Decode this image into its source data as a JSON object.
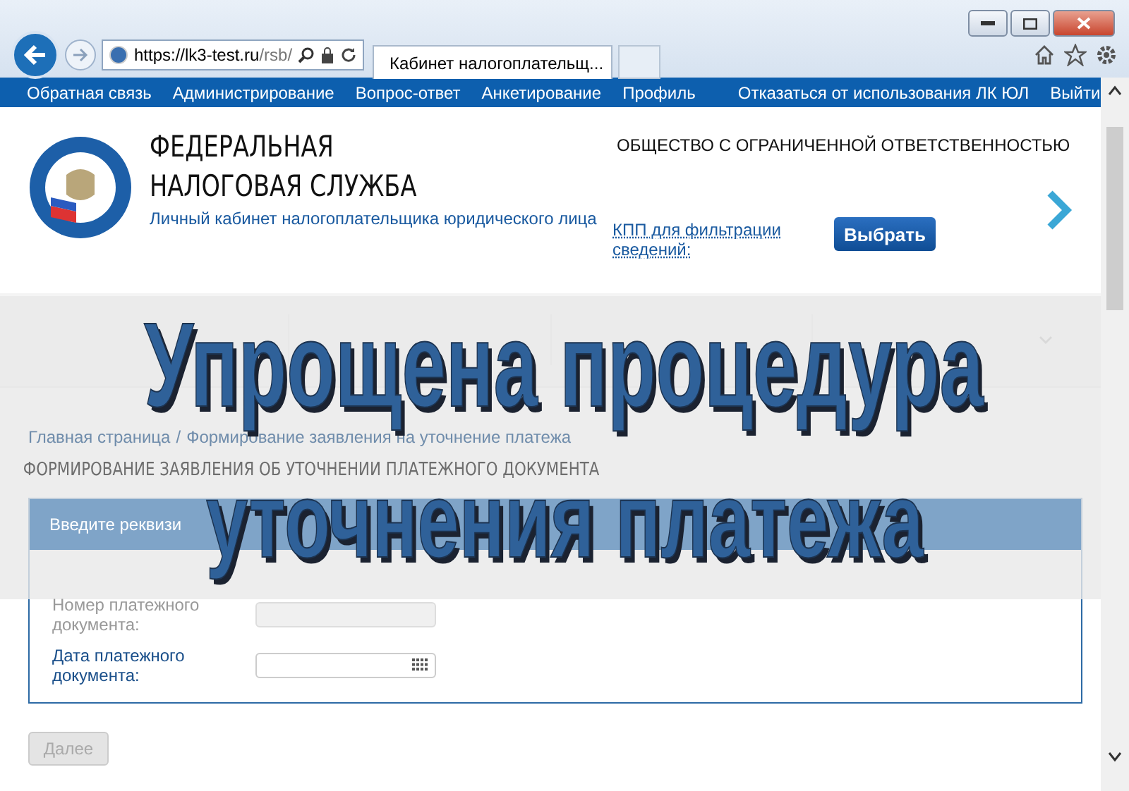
{
  "browser": {
    "address_host": "https://lk3-test.ru",
    "address_path": "/rsb/",
    "tab_title": "Кабинет налогоплательщ..."
  },
  "top_menu": {
    "left": [
      "Обратная связь",
      "Администрирование",
      "Вопрос-ответ",
      "Анкетирование",
      "Профиль"
    ],
    "right": [
      "Отказаться от использования ЛК ЮЛ",
      "Выйти"
    ]
  },
  "header": {
    "title_lines": [
      "ФЕДЕРАЛЬНАЯ",
      "НАЛОГОВАЯ СЛУЖБА"
    ],
    "subtitle": "Личный кабинет налогоплательщика юридического лица",
    "company": "ОБЩЕСТВО С ОГРАНИЧЕННОЙ ОТВЕТСТВЕННОСТЬЮ",
    "kpp_label": "КПП для фильтрации сведений:",
    "select_button": "Выбрать"
  },
  "breadcrumb": {
    "items": [
      "Главная страница",
      "Формирование заявления на уточнение платежа"
    ],
    "separator": "/"
  },
  "page_title": "ФОРМИРОВАНИЕ ЗАЯВЛЕНИЯ ОБ УТОЧНЕНИИ ПЛАТЕЖНОГО ДОКУМЕНТА",
  "form": {
    "header": "Введите реквизи",
    "fields": [
      {
        "label": "Номер платежного документа:",
        "kind": "text",
        "disabled": true
      },
      {
        "label": "Дата платежного документа:",
        "kind": "date",
        "disabled": false
      }
    ]
  },
  "next_button": {
    "label": "Далее",
    "disabled": true
  },
  "headline": [
    "Упрощена процедура",
    "уточнения платежа"
  ]
}
